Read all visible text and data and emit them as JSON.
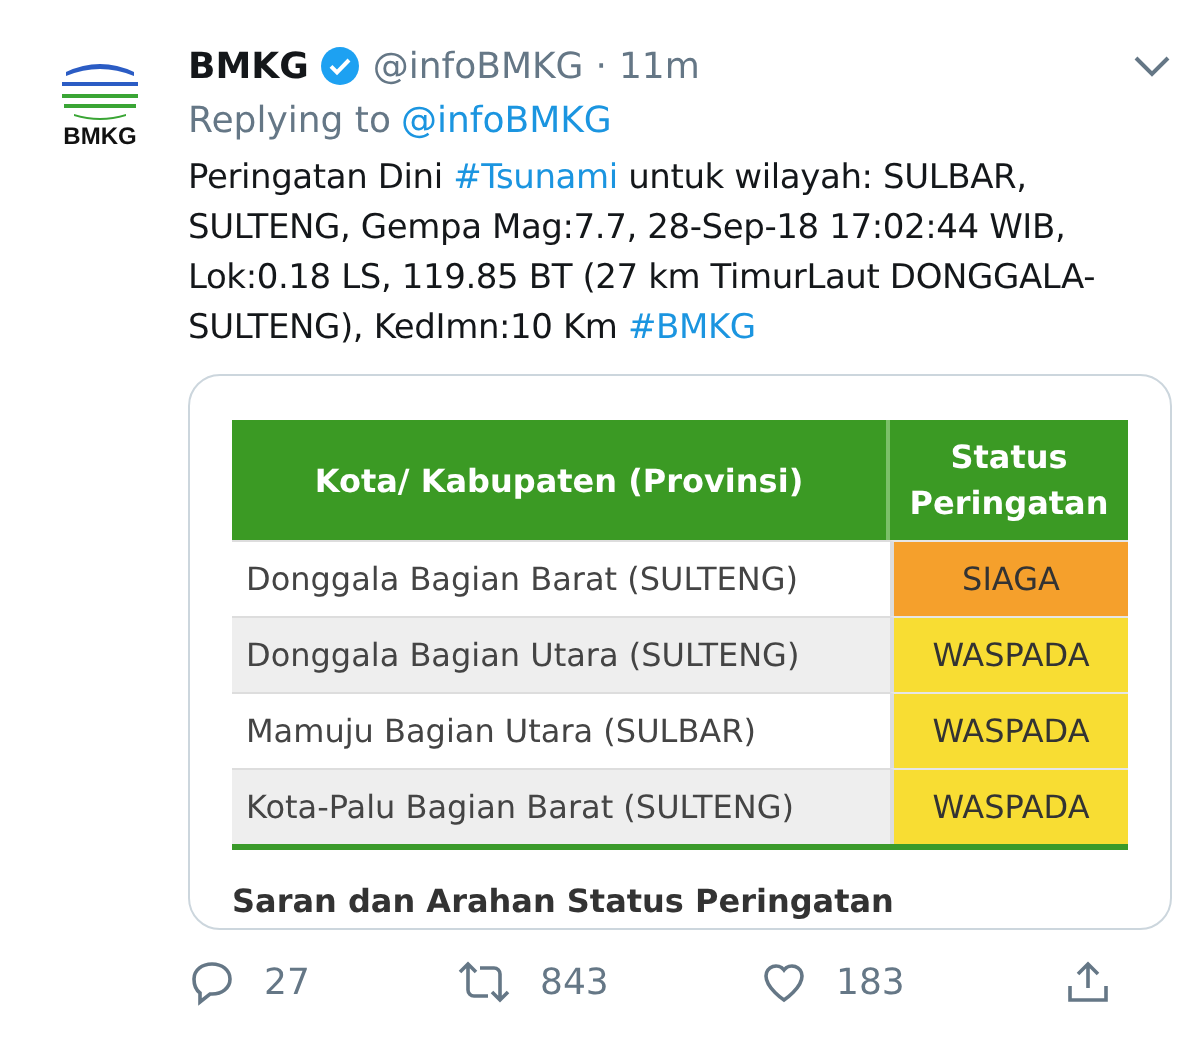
{
  "tweet": {
    "name": "BMKG",
    "verified": true,
    "handle": "@infoBMKG",
    "separator": "·",
    "time": "11m",
    "replying_label": "Replying to",
    "replying_handle": "@infoBMKG",
    "body": [
      {
        "kind": "text",
        "text": "Peringatan Dini "
      },
      {
        "kind": "hashtag",
        "text": "#Tsunami"
      },
      {
        "kind": "text",
        "text": " untuk wilayah: SULBAR, SULTENG, Gempa Mag:7.7, 28-Sep-18 17:02:44 WIB, Lok:0.18 LS, 119.85 BT (27 km TimurLaut DONGGALA-SULTENG), KedImn:10 Km "
      },
      {
        "kind": "hashtag",
        "text": "#BMKG"
      }
    ],
    "logo_text": "BMKG"
  },
  "media": {
    "table": {
      "columns": [
        "Kota/ Kabupaten (Provinsi)",
        "Status Peringatan"
      ],
      "rows": [
        {
          "area": "Donggala Bagian Barat (SULTENG)",
          "status": "SIAGA",
          "color": "#f5a02c"
        },
        {
          "area": "Donggala Bagian Utara (SULTENG)",
          "status": "WASPADA",
          "color": "#f8dd33"
        },
        {
          "area": "Mamuju Bagian Utara (SULBAR)",
          "status": "WASPADA",
          "color": "#f8dd33"
        },
        {
          "area": "Kota-Palu Bagian Barat (SULTENG)",
          "status": "WASPADA",
          "color": "#f8dd33"
        }
      ]
    },
    "section_heading": "Saran dan Arahan Status Peringatan"
  },
  "actions": [
    {
      "kind": "reply",
      "count": "27"
    },
    {
      "kind": "retweet",
      "count": "843"
    },
    {
      "kind": "like",
      "count": "183"
    },
    {
      "kind": "share"
    }
  ]
}
